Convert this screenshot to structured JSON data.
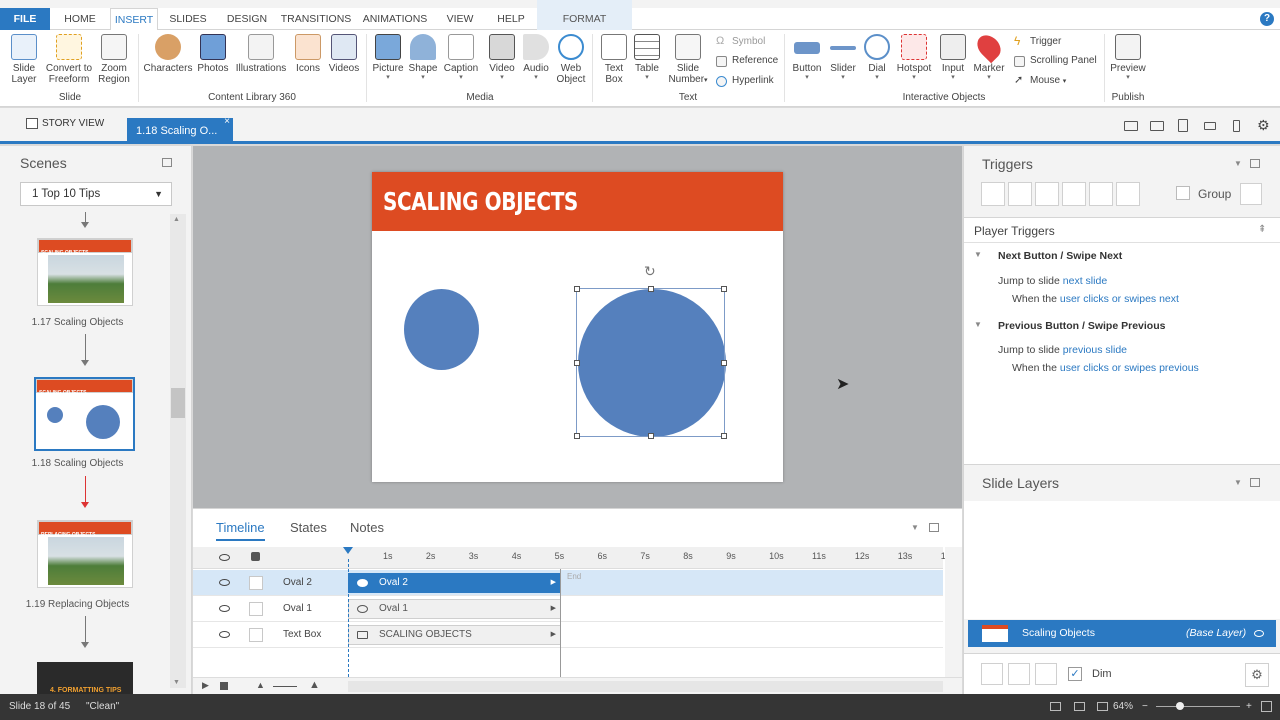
{
  "ribbon_tabs": {
    "file": "FILE",
    "home": "HOME",
    "insert": "INSERT",
    "slides": "SLIDES",
    "design": "DESIGN",
    "transitions": "TRANSITIONS",
    "animations": "ANIMATIONS",
    "view": "VIEW",
    "help": "HELP",
    "format": "FORMAT"
  },
  "help_icon": "?",
  "ribbon": {
    "slide_group": {
      "slide_layer": [
        "Slide",
        "Layer"
      ],
      "convert": [
        "Convert to",
        "Freeform"
      ],
      "zoom": [
        "Zoom",
        "Region"
      ],
      "label": "Slide"
    },
    "content_library": {
      "characters": "Characters",
      "photos": "Photos",
      "illustrations": "Illustrations",
      "icons": "Icons",
      "videos": "Videos",
      "label": "Content Library 360"
    },
    "media": {
      "picture": "Picture",
      "shape": "Shape",
      "caption": "Caption",
      "video": "Video",
      "audio": "Audio",
      "web_object": [
        "Web",
        "Object"
      ],
      "label": "Media"
    },
    "text": {
      "text_box": [
        "Text",
        "Box"
      ],
      "table": "Table",
      "slide_number": [
        "Slide",
        "Number"
      ],
      "symbol": "Symbol",
      "reference": "Reference",
      "hyperlink": "Hyperlink",
      "label": "Text"
    },
    "interactive": {
      "button": "Button",
      "slider": "Slider",
      "dial": "Dial",
      "hotspot": "Hotspot",
      "input": "Input",
      "marker": "Marker",
      "trigger": "Trigger",
      "scrolling_panel": "Scrolling Panel",
      "mouse": "Mouse",
      "label": "Interactive Objects"
    },
    "publish": {
      "preview": "Preview",
      "label": "Publish"
    }
  },
  "doc_tabs": {
    "story_view": "STORY VIEW",
    "current": "1.18 Scaling O...",
    "close": "×"
  },
  "scenes": {
    "title": "Scenes",
    "selected": "1 Top 10 Tips",
    "slides": [
      {
        "caption": "1.17 Scaling Objects",
        "header": "SCALING OBJECTS"
      },
      {
        "caption": "1.18 Scaling Objects",
        "header": "SCALING OBJECTS"
      },
      {
        "caption": "1.19 Replacing Objects",
        "header": "REPLACING OBJECTS"
      },
      {
        "caption": "",
        "header": "4. FORMATTING TIPS"
      }
    ]
  },
  "slide": {
    "title": "SCALING OBJECTS"
  },
  "timeline": {
    "tabs": {
      "timeline": "Timeline",
      "states": "States",
      "notes": "Notes"
    },
    "ticks": [
      "1s",
      "2s",
      "3s",
      "4s",
      "5s",
      "6s",
      "7s",
      "8s",
      "9s",
      "10s",
      "11s",
      "12s",
      "13s",
      "1"
    ],
    "end_label": "End",
    "rows": [
      {
        "name": "Oval 2",
        "bar": "Oval 2"
      },
      {
        "name": "Oval 1",
        "bar": "Oval 1"
      },
      {
        "name": "Text Box",
        "bar": "SCALING OBJECTS"
      }
    ]
  },
  "triggers": {
    "title": "Triggers",
    "group_label": "Group",
    "player_triggers": "Player Triggers",
    "next": {
      "heading": "Next Button / Swipe Next",
      "jump_prefix": "Jump to slide",
      "jump_target": "next slide",
      "when_prefix": "When the",
      "when_user": "user",
      "when_action": "clicks or swipes",
      "when_target": "next"
    },
    "previous": {
      "heading": "Previous Button / Swipe Previous",
      "jump_prefix": "Jump to slide",
      "jump_target": "previous slide",
      "when_prefix": "When the",
      "when_user": "user",
      "when_action": "clicks or swipes",
      "when_target": "previous"
    }
  },
  "layers": {
    "title": "Slide Layers",
    "base_name": "Scaling Objects",
    "base_tag": "(Base Layer)",
    "dim_label": "Dim"
  },
  "status": {
    "slide_count": "Slide 18 of 45",
    "theme": "\"Clean\"",
    "zoom": "64%"
  },
  "colors": {
    "accent": "#2b79c2",
    "header_orange": "#dd4b22",
    "oval_blue": "#5580bd"
  }
}
